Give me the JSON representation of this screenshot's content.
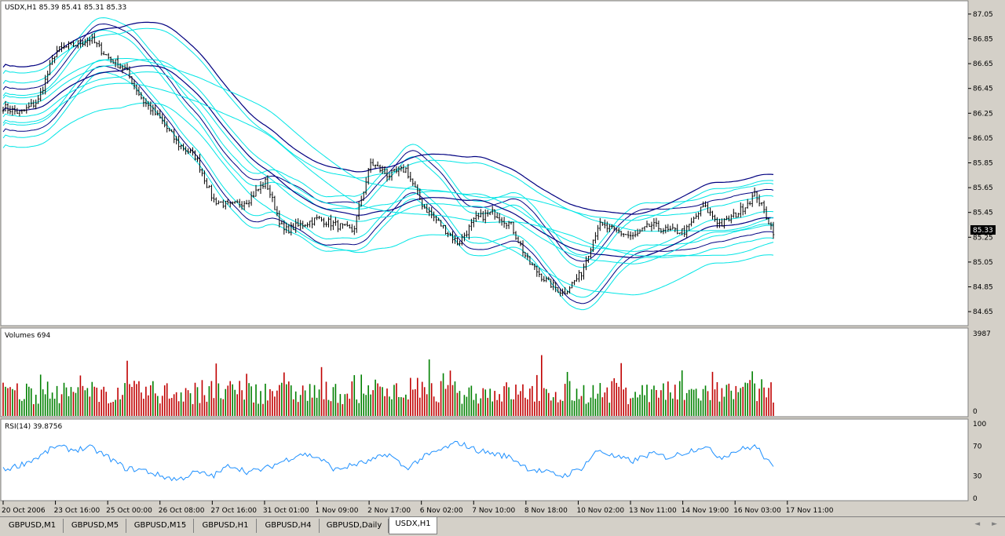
{
  "tabs": [
    "GBPUSD,M1",
    "GBPUSD,M5",
    "GBPUSD,M15",
    "GBPUSD,H1",
    "GBPUSD,H4",
    "GBPUSD,Daily",
    "USDX,H1"
  ],
  "active_tab": "USDX,H1",
  "scroll_arrows": "◄ ►",
  "chart_data": [
    {
      "type": "candlestick",
      "title": "USDX,H1  85.39 85.41 85.31 85.33",
      "current_price": "85.33",
      "ylim": [
        84.6,
        87.1
      ],
      "y_ticks": [
        "87.05",
        "86.85",
        "86.65",
        "86.45",
        "86.25",
        "86.05",
        "85.85",
        "85.65",
        "85.45",
        "85.25",
        "85.05",
        "84.85",
        "84.65"
      ],
      "x_ticks": [
        "20 Oct 2006",
        "23 Oct 16:00",
        "25 Oct 00:00",
        "26 Oct 08:00",
        "27 Oct 16:00",
        "31 Oct 01:00",
        "1 Nov 09:00",
        "2 Nov 17:00",
        "6 Nov 02:00",
        "7 Nov 10:00",
        "8 Nov 18:00",
        "10 Nov 02:00",
        "13 Nov 11:00",
        "14 Nov 19:00",
        "16 Nov 03:00",
        "17 Nov 11:00"
      ],
      "close_anchors": [
        86.3,
        86.25,
        86.35,
        86.75,
        86.8,
        86.85,
        86.7,
        86.6,
        86.35,
        86.2,
        86.0,
        85.9,
        85.55,
        85.5,
        85.55,
        85.7,
        85.3,
        85.35,
        85.4,
        85.35,
        85.3,
        85.85,
        85.75,
        85.8,
        85.5,
        85.35,
        85.2,
        85.4,
        85.45,
        85.35,
        85.05,
        84.9,
        84.8,
        84.95,
        85.35,
        85.3,
        85.25,
        85.35,
        85.3,
        85.3,
        85.5,
        85.35,
        85.45,
        85.6,
        85.3
      ],
      "colors": {
        "bars": "#000000",
        "envelope_inner": "#00e5e5",
        "envelope_outer": "#000080",
        "background": "#ffffff"
      }
    },
    {
      "type": "bar",
      "title": "Volumes 694",
      "ylim": [
        0,
        3987
      ],
      "y_ticks": [
        "3987",
        "0"
      ],
      "colors": {
        "up": "#008000",
        "down": "#c00000"
      }
    },
    {
      "type": "line",
      "title": "RSI(14) 39.8756",
      "ylim": [
        0,
        100
      ],
      "y_ticks": [
        "100",
        "70",
        "30",
        "0"
      ],
      "anchors": [
        38,
        45,
        55,
        70,
        65,
        68,
        55,
        40,
        38,
        30,
        25,
        35,
        30,
        45,
        35,
        40,
        50,
        60,
        55,
        38,
        45,
        50,
        60,
        40,
        55,
        65,
        75,
        65,
        60,
        55,
        40,
        35,
        30,
        40,
        65,
        55,
        50,
        60,
        55,
        62,
        70,
        55,
        65,
        70,
        40
      ],
      "colors": {
        "line": "#1e90ff"
      }
    }
  ]
}
